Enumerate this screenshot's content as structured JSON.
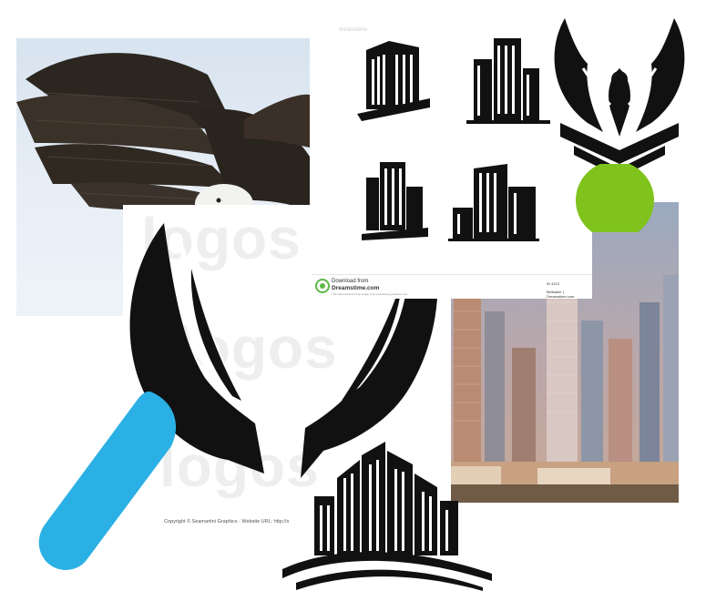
{
  "colors": {
    "green_circle": "#7fc31c",
    "blue_shape": "#2ab0e4",
    "ink": "#111111",
    "dreamstime_green": "#5db847"
  },
  "watermark": {
    "brand_word": "logos"
  },
  "copyright_line": "Copyright © Seamartini Graphics   ·   Website URL: http://s",
  "stock_card": {
    "download_line1": "Download from",
    "download_line2": "Dreamstime.com",
    "download_line3": "This watermarked comp image is for previewing purposes only.",
    "id_line": "ID 4213",
    "author_line": "Bellsaber | Dreamstime.com",
    "corner_mark": "dreamstime"
  },
  "icons": [
    "eagle-photo",
    "building-logo-1",
    "building-logo-2",
    "building-logo-3",
    "building-logo-4",
    "phoenix-emblem",
    "green-circle",
    "city-skyline-photo",
    "wings-logo",
    "blue-stroke-shape",
    "skyline-wave-logo"
  ]
}
